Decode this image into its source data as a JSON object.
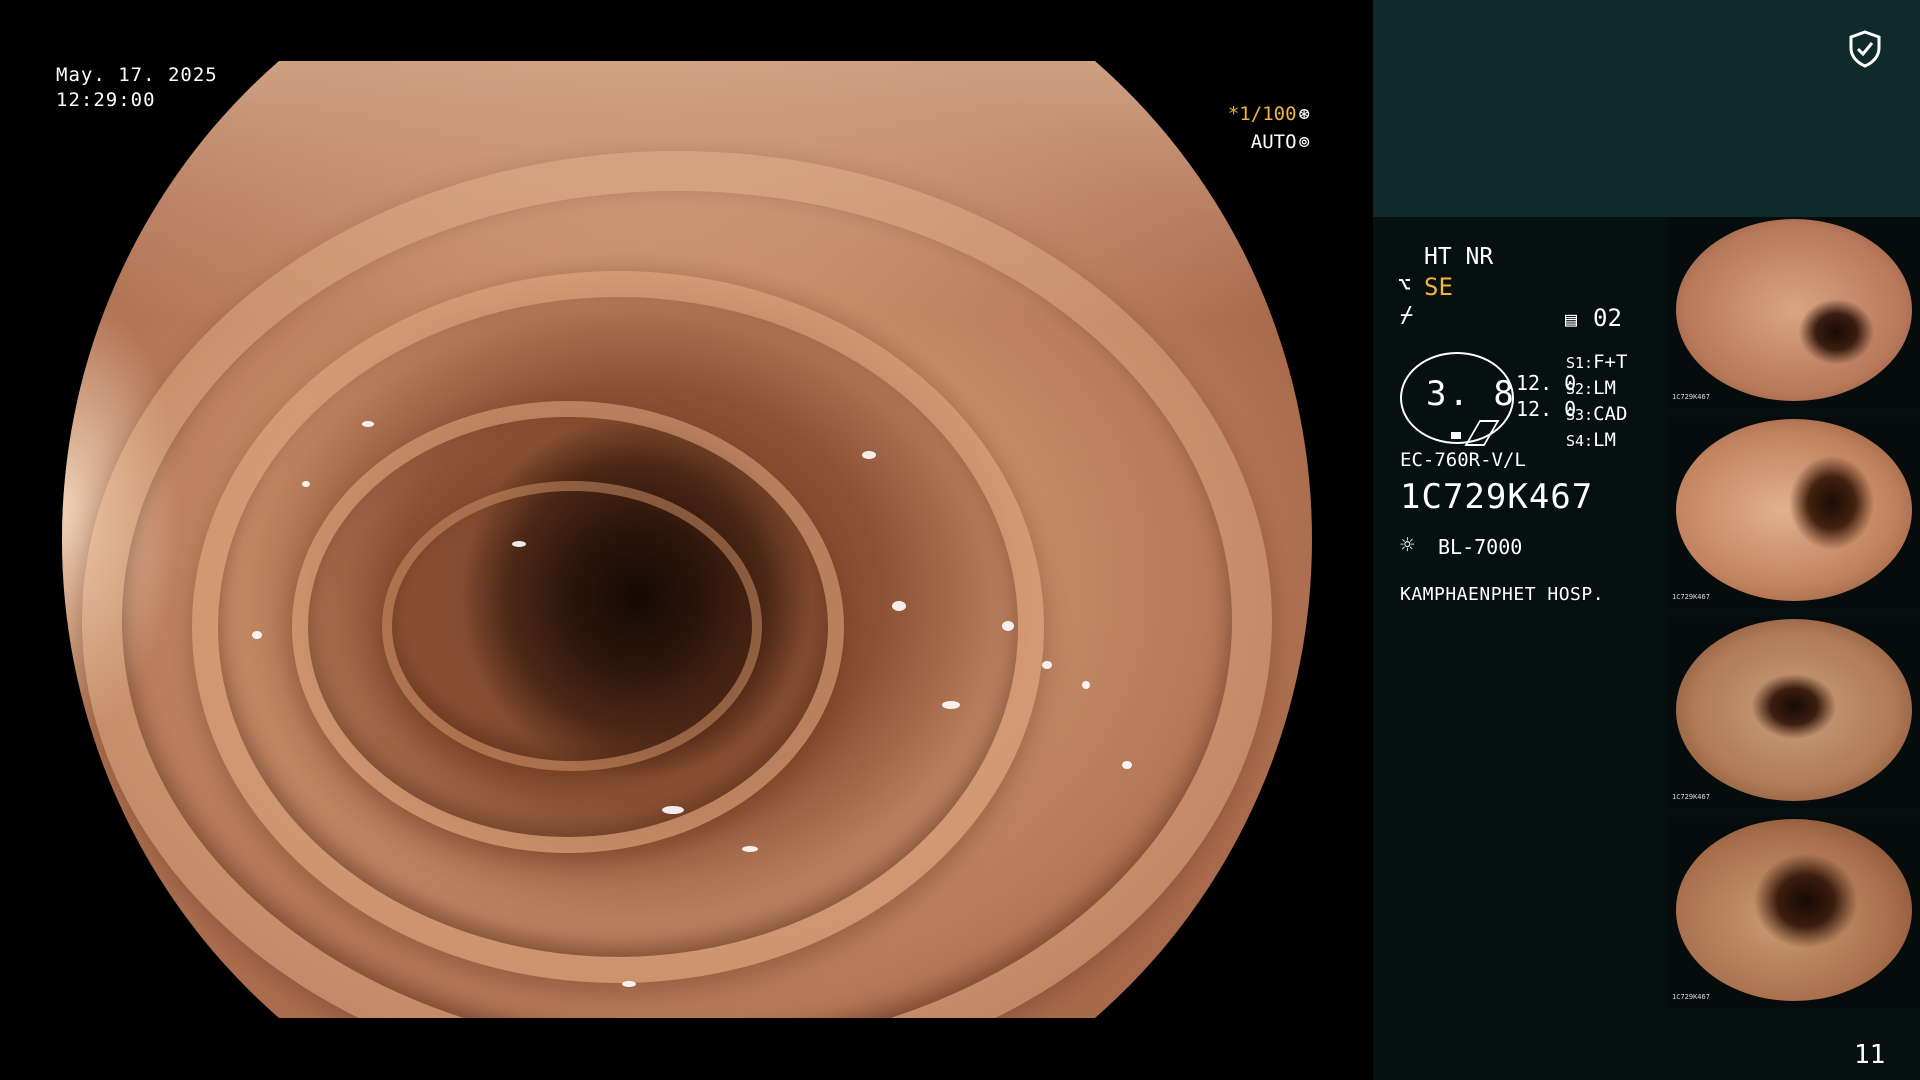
{
  "overlay": {
    "date": "May. 17. 2025",
    "time": "12:29:00",
    "shutter": "*1/100",
    "mode": "AUTO"
  },
  "panel": {
    "ht_nr": "HT NR",
    "se": "SE",
    "slot": "02",
    "gauge_value": "3. 8",
    "values": [
      "12. 0",
      "12. 0"
    ],
    "settings": [
      {
        "key": "S1:",
        "value": "F+T"
      },
      {
        "key": "S2:",
        "value": "LM"
      },
      {
        "key": "S3:",
        "value": "CAD"
      },
      {
        "key": "S4:",
        "value": "LM"
      }
    ],
    "model": "EC-760R-V/L",
    "serial": "1C729K467",
    "light_source": "BL-7000",
    "hospital": "KAMPHAENPHET HOSP.",
    "page_number": "11"
  },
  "thumbnails": [
    {
      "caption": "1C729K467"
    },
    {
      "caption": "1C729K467"
    },
    {
      "caption": "1C729K467"
    },
    {
      "caption": "1C729K467"
    }
  ],
  "icons": {
    "shield": "shield-check-icon",
    "scope": "scope-icon",
    "focus": "focus-icon",
    "slot": "memory-slot-icon",
    "light": "sun-icon",
    "shutter": "shutter-icon",
    "auto": "auto-iris-icon"
  },
  "colors": {
    "accent": "#f0b53a",
    "panel_top": "#0e2a2a",
    "panel_bottom": "#061010"
  }
}
